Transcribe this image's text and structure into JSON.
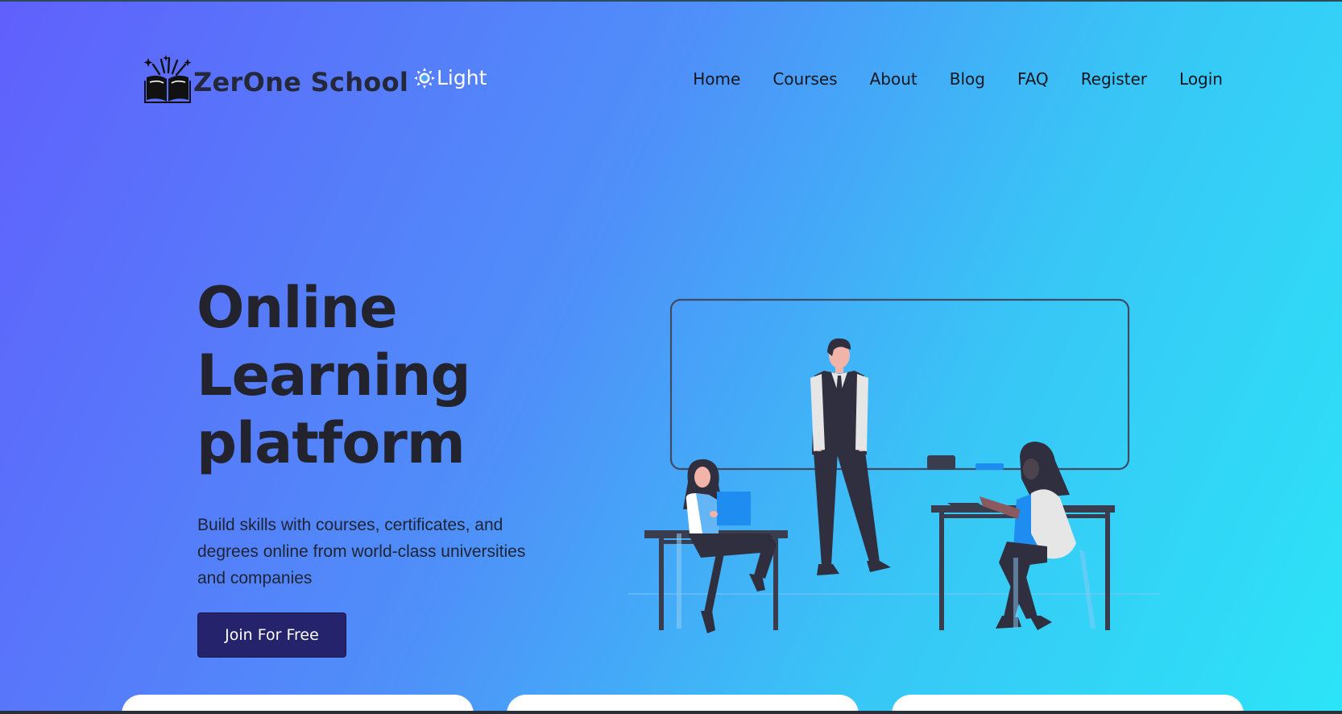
{
  "header": {
    "logo_text": "ZerOne School",
    "logo_icon": "book-sparkle-icon",
    "theme_toggle_label": "Light",
    "theme_icon": "sun-icon"
  },
  "nav": {
    "items": [
      {
        "label": "Home"
      },
      {
        "label": "Courses"
      },
      {
        "label": "About"
      },
      {
        "label": "Blog"
      },
      {
        "label": "FAQ"
      },
      {
        "label": "Register"
      },
      {
        "label": "Login"
      }
    ]
  },
  "hero": {
    "title_lines": [
      "Online",
      "Learning",
      "platform"
    ],
    "subtitle": "Build skills with courses, certificates, and degrees online from world-class universities and companies",
    "cta_label": "Join For Free",
    "illustration": "classroom-illustration"
  },
  "colors": {
    "gradient_start": "#6060fc",
    "gradient_end": "#2ce4f7",
    "cta_background": "#25236b",
    "heading": "#23232e"
  }
}
